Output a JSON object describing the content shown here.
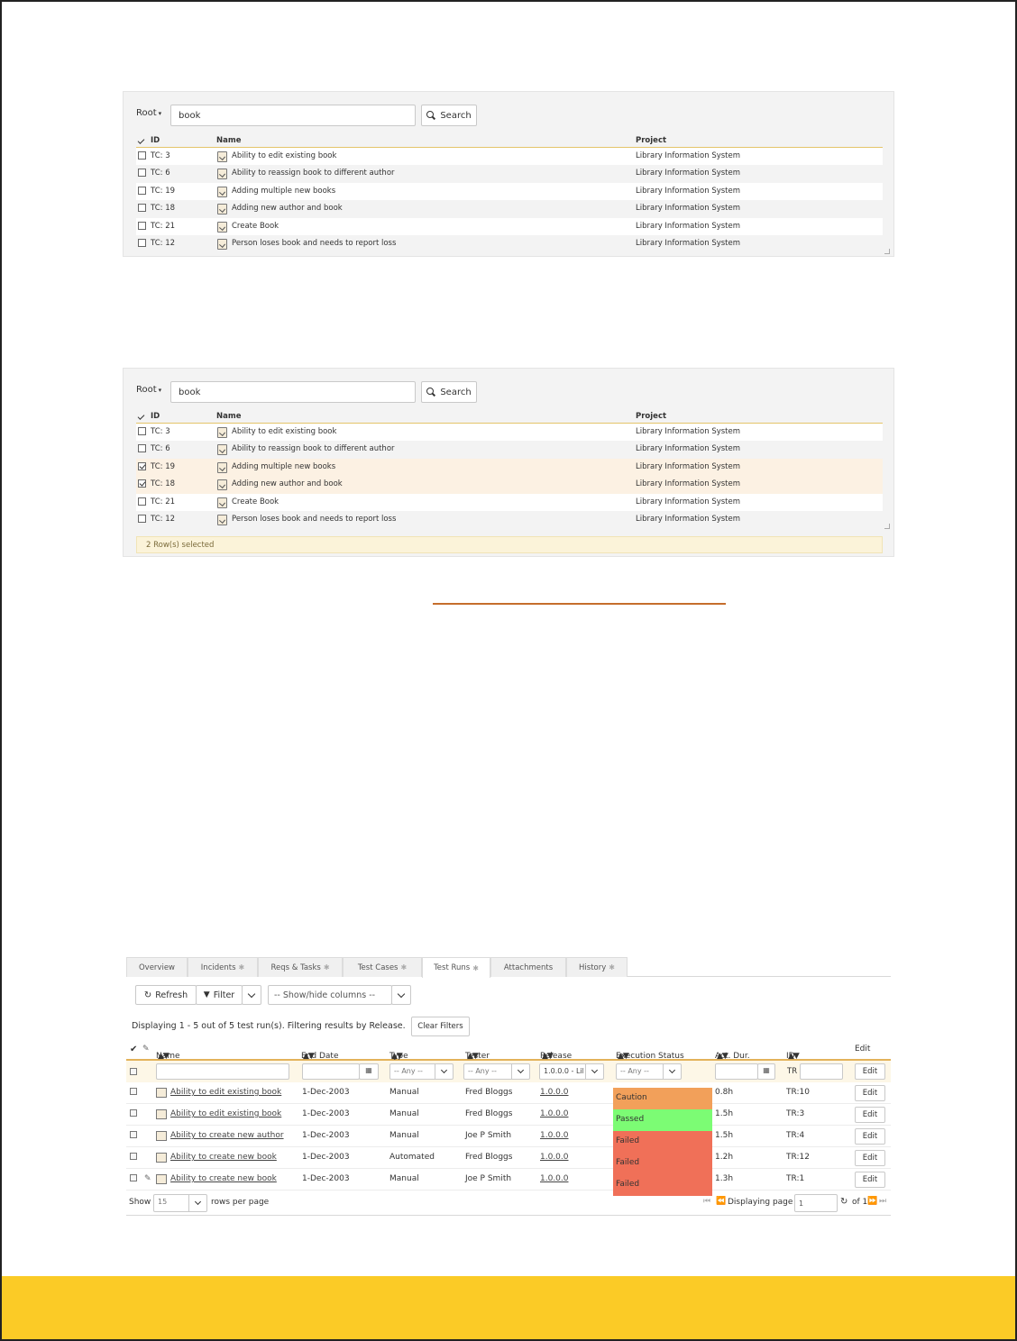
{
  "picker1": {
    "root_label": "Root",
    "search_value": "book",
    "search_button": "Search",
    "columns": [
      "ID",
      "Name",
      "Project"
    ],
    "rows": [
      {
        "id": "TC: 3",
        "name": "Ability to edit existing book",
        "project": "Library Information System"
      },
      {
        "id": "TC: 6",
        "name": "Ability to reassign book to different author",
        "project": "Library Information System"
      },
      {
        "id": "TC: 19",
        "name": "Adding multiple new books",
        "project": "Library Information System"
      },
      {
        "id": "TC: 18",
        "name": "Adding new author and book",
        "project": "Library Information System"
      },
      {
        "id": "TC: 21",
        "name": "Create Book",
        "project": "Library Information System"
      },
      {
        "id": "TC: 12",
        "name": "Person loses book and needs to report loss",
        "project": "Library Information System"
      }
    ]
  },
  "picker2": {
    "root_label": "Root",
    "search_value": "book",
    "search_button": "Search",
    "columns": [
      "ID",
      "Name",
      "Project"
    ],
    "rows": [
      {
        "id": "TC: 3",
        "name": "Ability to edit existing book",
        "project": "Library Information System",
        "checked": false
      },
      {
        "id": "TC: 6",
        "name": "Ability to reassign book to different author",
        "project": "Library Information System",
        "checked": false
      },
      {
        "id": "TC: 19",
        "name": "Adding multiple new books",
        "project": "Library Information System",
        "checked": true
      },
      {
        "id": "TC: 18",
        "name": "Adding new author and book",
        "project": "Library Information System",
        "checked": true
      },
      {
        "id": "TC: 21",
        "name": "Create Book",
        "project": "Library Information System",
        "checked": false
      },
      {
        "id": "TC: 12",
        "name": "Person loses book and needs to report loss",
        "project": "Library Information System",
        "checked": false
      }
    ],
    "selected_text": "2 Row(s) selected"
  },
  "testruns": {
    "tabs": [
      {
        "label": "Overview",
        "star": false
      },
      {
        "label": "Incidents",
        "star": true
      },
      {
        "label": "Reqs & Tasks",
        "star": true
      },
      {
        "label": "Test Cases",
        "star": true
      },
      {
        "label": "Test Runs",
        "star": true
      },
      {
        "label": "Attachments",
        "star": false
      },
      {
        "label": "History",
        "star": true
      }
    ],
    "refresh_label": "Refresh",
    "filter_label": "Filter",
    "showhide_label": "-- Show/hide columns --",
    "displaying_text": "Displaying 1 - 5 out of 5 test run(s). Filtering results by Release.",
    "clear_filters": "Clear Filters",
    "columns": {
      "name": "Name",
      "end_date": "End Date",
      "type": "Type",
      "tester": "Tester",
      "release": "Release",
      "status": "Execution Status",
      "duration": "Act. Dur.",
      "id": "ID",
      "edit": "Edit"
    },
    "filters": {
      "type": "-- Any --",
      "tester": "-- Any --",
      "release": "1.0.0.0 - Lib",
      "status": "-- Any --",
      "id_prefix": "TR",
      "edit": "Edit"
    },
    "rows": [
      {
        "name": "Ability to edit existing book",
        "end": "1-Dec-2003",
        "type": "Manual",
        "tester": "Fred Bloggs",
        "release": "1.0.0.0",
        "status": "Caution",
        "dur": "0.8h",
        "id": "TR:10",
        "edit": "Edit",
        "attach": false
      },
      {
        "name": "Ability to edit existing book",
        "end": "1-Dec-2003",
        "type": "Manual",
        "tester": "Fred Bloggs",
        "release": "1.0.0.0",
        "status": "Passed",
        "dur": "1.5h",
        "id": "TR:3",
        "edit": "Edit",
        "attach": false
      },
      {
        "name": "Ability to create new author",
        "end": "1-Dec-2003",
        "type": "Manual",
        "tester": "Joe P Smith",
        "release": "1.0.0.0",
        "status": "Failed",
        "dur": "1.5h",
        "id": "TR:4",
        "edit": "Edit",
        "attach": false
      },
      {
        "name": "Ability to create new book",
        "end": "1-Dec-2003",
        "type": "Automated",
        "tester": "Fred Bloggs",
        "release": "1.0.0.0",
        "status": "Failed",
        "dur": "1.2h",
        "id": "TR:12",
        "edit": "Edit",
        "attach": false
      },
      {
        "name": "Ability to create new book",
        "end": "1-Dec-2003",
        "type": "Manual",
        "tester": "Joe P Smith",
        "release": "1.0.0.0",
        "status": "Failed",
        "dur": "1.3h",
        "id": "TR:1",
        "edit": "Edit",
        "attach": true
      }
    ],
    "status_colors": {
      "Caution": "#f2a05a",
      "Passed": "#7cfc74",
      "Failed": "#f07058"
    },
    "show_label": "Show",
    "per_page_value": "15",
    "rows_per_page": "rows per page",
    "displaying_page": "Displaying page",
    "page_value": "1",
    "of_pages": "of 1"
  },
  "colors": {
    "accent_band": "#fbcb26",
    "separator": "#c56e2c"
  }
}
